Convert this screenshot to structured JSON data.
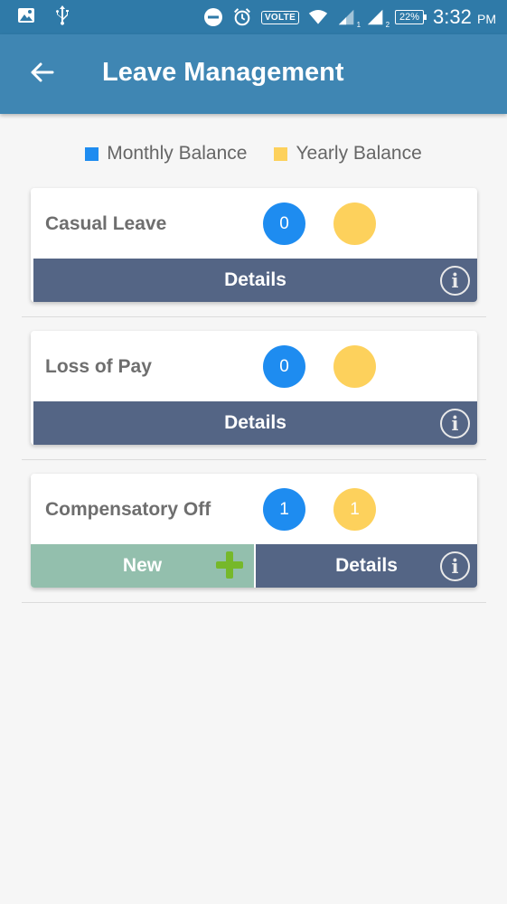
{
  "status_bar": {
    "icons_left": [
      "image-icon",
      "usb-icon"
    ],
    "icons_right": [
      "dnd-icon",
      "alarm-icon",
      "volte-badge",
      "wifi-icon",
      "signal-1-icon",
      "signal-2-icon",
      "battery-icon"
    ],
    "volte": "VOLTE",
    "signal_sim1": "1",
    "signal_sim2": "2",
    "battery": "22%",
    "time": "3:32",
    "ampm": "PM"
  },
  "app_bar": {
    "title": "Leave Management",
    "back_icon": "arrow-left-icon"
  },
  "legend": [
    {
      "label": "Monthly Balance",
      "color": "#1e8cf0"
    },
    {
      "label": "Yearly Balance",
      "color": "#fdd15c"
    }
  ],
  "colors": {
    "monthly": "#1e8cf0",
    "yearly": "#fdd15c",
    "details_bar": "#546585",
    "new_bar": "#93bfad",
    "plus": "#76b82a"
  },
  "cards": [
    {
      "name": "Casual Leave",
      "monthly": "0",
      "yearly": "",
      "details": "Details",
      "info_icon": "i"
    },
    {
      "name": "Loss of Pay",
      "monthly": "0",
      "yearly": "",
      "details": "Details",
      "info_icon": "i"
    },
    {
      "name": "Compensatory Off",
      "monthly": "1",
      "yearly": "1",
      "new": "New",
      "details": "Details",
      "info_icon": "i"
    }
  ]
}
